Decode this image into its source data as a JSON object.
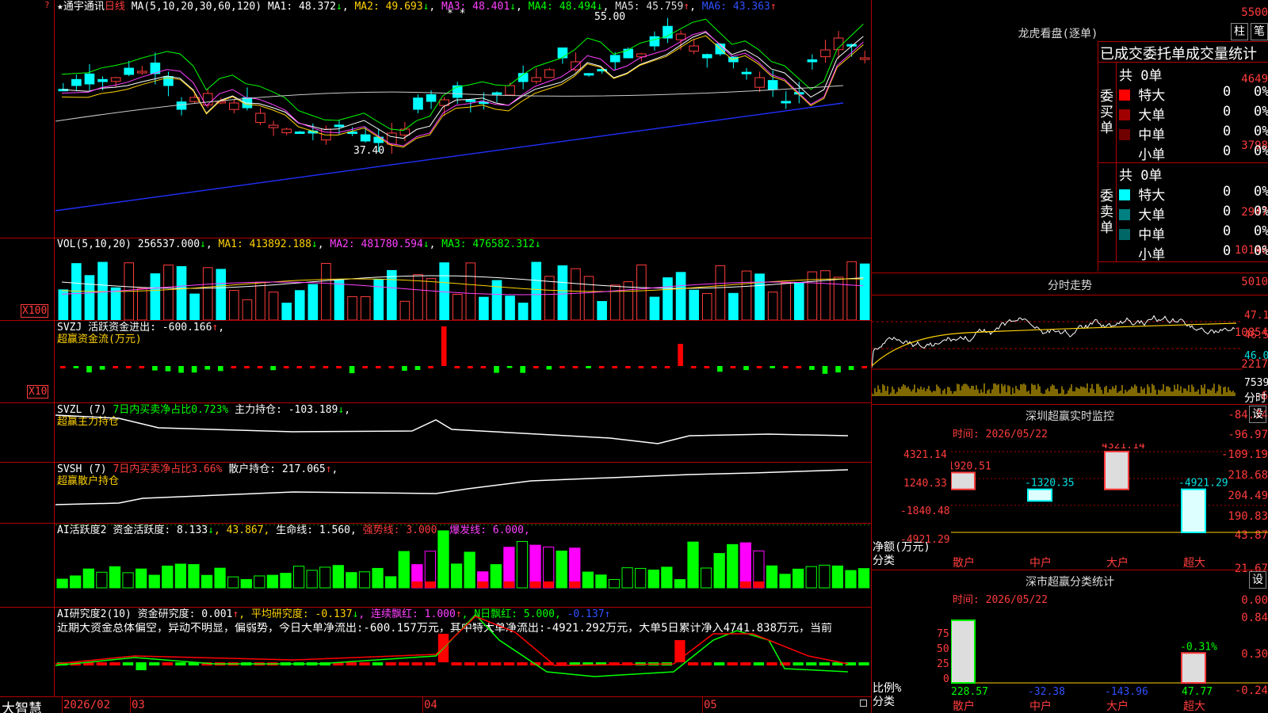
{
  "stock": {
    "star": "★",
    "name": "通宇通讯",
    "period": "日线"
  },
  "price_panel": {
    "ma_params": "MA(5,10,20,30,60,120)",
    "ma1": "MA1: 48.372",
    "ma1_arrow": "↓",
    "ma2": "MA2: 49.693",
    "ma2_arrow": "↓",
    "ma3": "MA3: 48.401",
    "ma3_arrow": "↓",
    "ma4": "MA4: 48.494",
    "ma4_arrow": "↓",
    "ma5": "MA5: 45.759",
    "ma5_arrow": "↑",
    "ma6": "MA6: 43.363",
    "ma6_arrow": "↑",
    "ticks": [
      "5500",
      "4649",
      "3798",
      "2947"
    ],
    "high_label": "55.00",
    "low_label": "37.40",
    "stars": "* *"
  },
  "vol_panel": {
    "params": "VOL(5,10,20)",
    "value": "256537.000",
    "value_arrow": "↓",
    "ma1": "MA1: 413892.188",
    "ma1_arrow": "↓",
    "ma2": "MA2: 481780.594",
    "ma2_arrow": "↓",
    "ma3": "MA3: 476582.312",
    "ma3_arrow": "↓",
    "ticks": [
      "10146",
      "5010"
    ],
    "unit": "X100"
  },
  "svzj_panel": {
    "name": "SVZJ",
    "label": "活跃资金进出: -600.166",
    "arrow": "↑",
    "subtitle": "超赢资金流(万元)",
    "ticks": [
      "10854",
      "2217",
      "-6"
    ],
    "unit": "X10"
  },
  "svzl_panel": {
    "name": "SVZL (7)",
    "ratio": "7日内买卖净占比0.723%",
    "hold": "主力持仓: -103.189",
    "hold_arrow": "↓",
    "comma": ",",
    "subtitle": "超赢主力持仓",
    "ticks": [
      "-84.74",
      "-96.97",
      "-109.19"
    ]
  },
  "svsh_panel": {
    "name": "SVSH (7)",
    "ratio": "7日内买卖净占比3.66%",
    "hold": "散户持仓: 217.065",
    "hold_arrow": "↑",
    "comma": ",",
    "subtitle": "超赢散户持仓",
    "ticks": [
      "218.68",
      "204.49",
      "190.83"
    ]
  },
  "ai_act_panel": {
    "name": "AI活跃度2",
    "act": "资金活跃度: 8.133",
    "act_arrow": "↓",
    "v2": ", 43.867,",
    "life": "生命线: 1.560,",
    "strong": "强势线: 3.000,",
    "burst": "爆发线: 6.000,",
    "ticks": [
      "43.87",
      "21.67",
      "0.00"
    ]
  },
  "ai_res_panel": {
    "name": "AI研究度2(10)",
    "res": "资金研究度: 0.001",
    "res_arrow": "↑",
    "avg": ", 平均研究度: -0.137",
    "avg_arrow": "↓",
    "red": ", 连续飘红: 1.000",
    "red_arrow": "↑",
    "nred": ", N日飘红: 5.000,",
    "last": "-0.137",
    "last_arrow": "↑",
    "text": "近期大资金总体偏空，异动不明显，偏弱势，今日大单净流出:-600.157万元，其中特大单净流出:-4921.292万元，大单5日累计净入4741.838万元，当前",
    "ticks": [
      "0.84",
      "0.30",
      "-0.24"
    ]
  },
  "bottom": {
    "brand": "大智慧",
    "dates": [
      "2026/02",
      "03",
      "04",
      "05"
    ]
  },
  "lhb": {
    "title": "龙虎看盘(逐单)",
    "btn_bar": "柱",
    "btn_tick": "笔",
    "header": "已成交委托单成交量统计",
    "buy_label": "委买单",
    "sell_label": "委卖单",
    "buy_total": "共 0单",
    "sell_total": "共 0单",
    "buy_rows": [
      {
        "label": "特大",
        "count": "0",
        "pct": "0%",
        "color": "#ff0000"
      },
      {
        "label": "大单",
        "count": "0",
        "pct": "0%",
        "color": "#a00000"
      },
      {
        "label": "中单",
        "count": "0",
        "pct": "0%",
        "color": "#700000"
      },
      {
        "label": "小单",
        "count": "0",
        "pct": "0%",
        "color": "#000000"
      }
    ],
    "sell_rows": [
      {
        "label": "特大",
        "count": "0",
        "pct": "0%",
        "color": "#00ffff"
      },
      {
        "label": "大单",
        "count": "0",
        "pct": "0%",
        "color": "#008080"
      },
      {
        "label": "中单",
        "count": "0",
        "pct": "0%",
        "color": "#006666"
      },
      {
        "label": "小单",
        "count": "0",
        "pct": "0%",
        "color": "#000000"
      }
    ]
  },
  "intraday": {
    "title": "分时走势",
    "ticks": [
      "47.11",
      "46.59",
      "46.07"
    ],
    "vol_tick": "7539",
    "unit": "分时"
  },
  "monitor": {
    "title": "深圳超赢实时监控",
    "btn": "设",
    "time": "时间: 2026/05/22",
    "ticks": [
      "4321.14",
      "1240.33",
      "-1840.48",
      "-4921.29"
    ],
    "ylabel": "净额(万元)",
    "xlabel": "分类",
    "chart_data": {
      "type": "bar",
      "categories": [
        "散户",
        "中户",
        "大户",
        "超大"
      ],
      "values": [
        1920.51,
        -1320.35,
        4321.14,
        -4921.29
      ],
      "ylim": [
        -4921.29,
        4321.14
      ]
    },
    "value_labels": [
      "1920.51",
      "-1320.35",
      "4321.14",
      "-4921.29"
    ]
  },
  "classify": {
    "title": "深市超赢分类统计",
    "btn": "设",
    "time": "时间: 2026/05/22",
    "ticks": [
      "75",
      "50",
      "25",
      "0"
    ],
    "ylabel": "比例%",
    "xlabel": "分类",
    "chart_data": {
      "type": "bar",
      "categories": [
        "散户",
        "中户",
        "大户",
        "超大"
      ],
      "values": [
        228.57,
        -32.38,
        -143.96,
        47.77
      ],
      "ylim": [
        0,
        100
      ]
    },
    "value_labels": [
      "228.57",
      "-32.38",
      "-143.96",
      "47.77"
    ],
    "top_label": "-0.31%"
  }
}
